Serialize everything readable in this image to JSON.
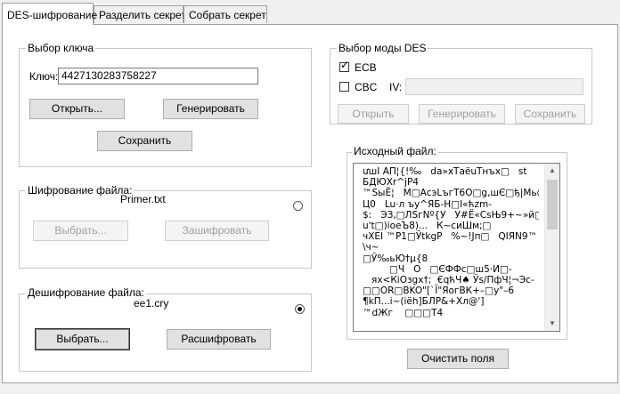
{
  "tabs": [
    {
      "label": "DES-шифрование"
    },
    {
      "label": "Разделить секрет"
    },
    {
      "label": "Собрать секрет"
    }
  ],
  "key_group": {
    "legend": "Выбор ключа",
    "key_label": "Ключ:",
    "key_value": "4427130283758227",
    "open_button": "Открыть...",
    "generate_button": "Генерировать",
    "save_button": "Сохранить"
  },
  "encrypt_group": {
    "legend": "Шифрование файла:",
    "filename": "Primer.txt",
    "select_button": "Выбрать...",
    "encrypt_button": "Зашифровать",
    "radio_selected": false
  },
  "decrypt_group": {
    "legend": "Дешифрование файла:",
    "filename": "ee1.cry",
    "select_button": "Выбрать...",
    "decrypt_button": "Расшифровать",
    "radio_selected": true
  },
  "mode_group": {
    "legend": "Выбор моды DES",
    "ecb_label": "ECB",
    "ecb_checked": true,
    "cbc_label": "CBC",
    "cbc_checked": false,
    "iv_label": "IV:",
    "iv_value": "",
    "open_button": "Открыть",
    "generate_button": "Генерировать",
    "save_button": "Сохранить"
  },
  "source_group": {
    "legend": "Исходный файл:",
    "content": "ưшІ АП¦{!‰   da»хТаёuТнъх□   st\nБДЮХr^jР4\n™SыЁ¦   М□АсэLъгТ6О□g,шЄ□ђ|Мь@\nЦ0   Lu·л ъу^ЯБ-Н□I«ћzm-\n$:   ЭЗ,□ЛSгNº{У   У#Ё«СsЊ9+~»й□}\nu't□)ioeЪ8)...   К~сиШм;□\nчХЕI ™Р1□ЎtkgP   %~!Jп□   QIЯN9™\n\\ч~\n□Ў‰ьЮ†µ{8\n         □Ч   О   □ЄФФс□ш5·И□-\n   ях<КiОзgх†;  €qћЧ♠ Ўs/ПфЧ¦¬Эс-\n□□OR□BKO\"[`Ї\"ЯогВК+–□у\"–6\n¶kП...i~(іёh]БЛР&+Хл@']\n™dЖг    □□□Т4",
    "clear_button": "Очистить поля"
  }
}
